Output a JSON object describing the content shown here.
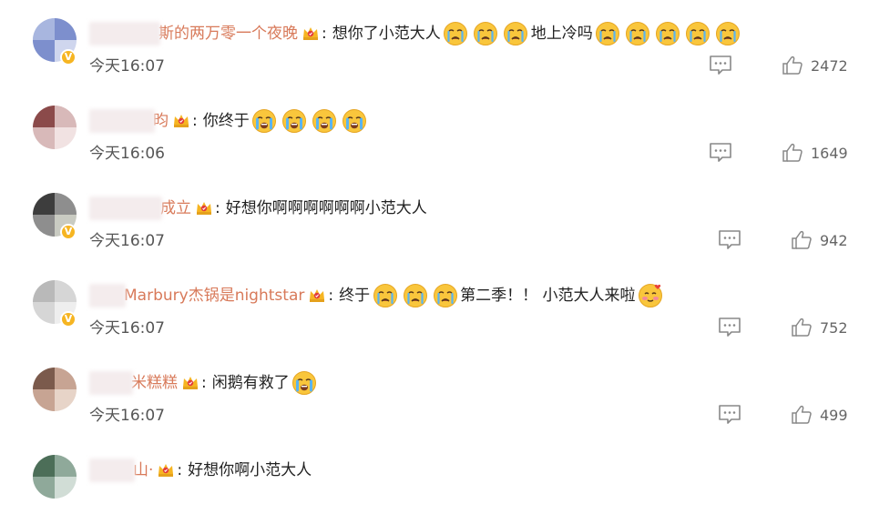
{
  "comments": [
    {
      "username": "斯的两万零一个夜晚",
      "text_parts": [
        {
          "kind": "text",
          "value": "想你了小范大人"
        },
        {
          "kind": "emoji",
          "icon": "crying-face-icon",
          "count": 3
        },
        {
          "kind": "text",
          "value": "地上冷吗"
        },
        {
          "kind": "emoji",
          "icon": "crying-face-icon",
          "count": 5
        }
      ],
      "time": "今天16:07",
      "likes": "2472",
      "verified": true
    },
    {
      "username": "昀",
      "text_parts": [
        {
          "kind": "text",
          "value": "你终于"
        },
        {
          "kind": "emoji",
          "icon": "sobbing-face-icon",
          "count": 4
        }
      ],
      "time": "今天16:06",
      "likes": "1649",
      "verified": false
    },
    {
      "username": "成立",
      "text_parts": [
        {
          "kind": "text",
          "value": "好想你啊啊啊啊啊啊小范大人"
        }
      ],
      "time": "今天16:07",
      "likes": "942",
      "verified": true
    },
    {
      "username": "Marbury杰锅是nightstar",
      "text_parts": [
        {
          "kind": "text",
          "value": "终于"
        },
        {
          "kind": "emoji",
          "icon": "crying-face-icon",
          "count": 3
        },
        {
          "kind": "text",
          "value": "第二季！！ 小范大人来啦"
        },
        {
          "kind": "emoji",
          "icon": "loving-face-icon",
          "count": 1
        }
      ],
      "time": "今天16:07",
      "likes": "752",
      "verified": true
    },
    {
      "username": "米糕糕",
      "text_parts": [
        {
          "kind": "text",
          "value": "闲鹅有救了"
        },
        {
          "kind": "emoji",
          "icon": "sobbing-face-icon",
          "count": 1
        }
      ],
      "time": "今天16:07",
      "likes": "499",
      "verified": false
    },
    {
      "username": "山·",
      "text_parts": [
        {
          "kind": "text",
          "value": "好想你啊小范大人"
        }
      ],
      "time": "",
      "likes": "",
      "verified": false
    }
  ],
  "colon": ":",
  "verified_mark": "V",
  "colors": {
    "username": "#d87a5a",
    "text": "#222222",
    "meta": "#666666",
    "badge": "#f6b522",
    "emoji_face": "#f9c63c",
    "emoji_tears": "#5ab4f0"
  }
}
